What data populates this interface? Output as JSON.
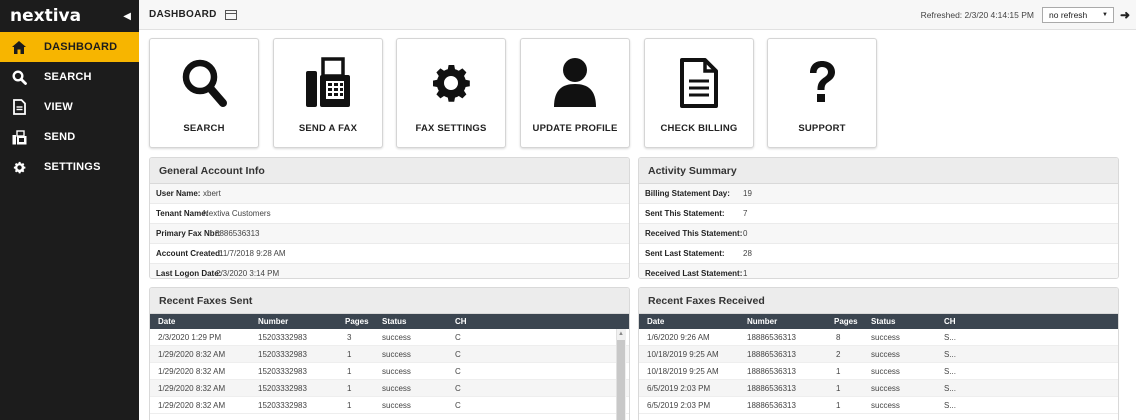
{
  "app": {
    "brand": "nextiva"
  },
  "sidebar": {
    "items": [
      {
        "label": "DASHBOARD",
        "icon": "home-icon",
        "active": true
      },
      {
        "label": "SEARCH",
        "icon": "search-icon",
        "active": false
      },
      {
        "label": "VIEW",
        "icon": "document-icon",
        "active": false
      },
      {
        "label": "SEND",
        "icon": "fax-icon",
        "active": false
      },
      {
        "label": "SETTINGS",
        "icon": "gear-icon",
        "active": false
      }
    ]
  },
  "topbar": {
    "title": "DASHBOARD",
    "refreshed": "Refreshed: 2/3/20 4:14:15 PM",
    "refresh_select": "no refresh"
  },
  "tiles": [
    {
      "label": "SEARCH",
      "icon": "search-icon"
    },
    {
      "label": "SEND A FAX",
      "icon": "fax-icon"
    },
    {
      "label": "FAX SETTINGS",
      "icon": "gear-icon"
    },
    {
      "label": "UPDATE PROFILE",
      "icon": "user-icon"
    },
    {
      "label": "CHECK BILLING",
      "icon": "document-icon"
    },
    {
      "label": "SUPPORT",
      "icon": "question-icon"
    }
  ],
  "account_info": {
    "title": "General Account Info",
    "rows": [
      {
        "key": "User Name:",
        "value": "xbert"
      },
      {
        "key": "Tenant Name:",
        "value": "Nextiva Customers"
      },
      {
        "key": "Primary Fax Nbr:",
        "value": "8886536313"
      },
      {
        "key": "Account Created:",
        "value": "11/7/2018 9:28 AM"
      },
      {
        "key": "Last Logon Date:",
        "value": "2/3/2020 3:14 PM"
      }
    ]
  },
  "activity_summary": {
    "title": "Activity Summary",
    "rows": [
      {
        "key": "Billing Statement Day:",
        "value": "19"
      },
      {
        "key": "Sent This Statement:",
        "value": "7"
      },
      {
        "key": "Received This Statement:",
        "value": "0"
      },
      {
        "key": "Sent Last Statement:",
        "value": "28"
      },
      {
        "key": "Received Last Statement:",
        "value": "1"
      }
    ]
  },
  "recent_sent": {
    "title": "Recent Faxes Sent",
    "columns": [
      "Date",
      "Number",
      "Pages",
      "Status",
      "CH"
    ],
    "rows": [
      [
        "2/3/2020 1:29 PM",
        "15203332983",
        "3",
        "success",
        "C"
      ],
      [
        "1/29/2020 8:32 AM",
        "15203332983",
        "1",
        "success",
        "C"
      ],
      [
        "1/29/2020 8:32 AM",
        "15203332983",
        "1",
        "success",
        "C"
      ],
      [
        "1/29/2020 8:32 AM",
        "15203332983",
        "1",
        "success",
        "C"
      ],
      [
        "1/29/2020 8:32 AM",
        "15203332983",
        "1",
        "success",
        "C"
      ]
    ]
  },
  "recent_received": {
    "title": "Recent Faxes Received",
    "columns": [
      "Date",
      "Number",
      "Pages",
      "Status",
      "CH"
    ],
    "rows": [
      [
        "1/6/2020 9:26 AM",
        "18886536313",
        "8",
        "success",
        "S..."
      ],
      [
        "10/18/2019 9:25 AM",
        "18886536313",
        "2",
        "success",
        "S..."
      ],
      [
        "10/18/2019 9:25 AM",
        "18886536313",
        "1",
        "success",
        "S..."
      ],
      [
        "6/5/2019 2:03 PM",
        "18886536313",
        "1",
        "success",
        "S..."
      ],
      [
        "6/5/2019 2:03 PM",
        "18886536313",
        "1",
        "success",
        "S..."
      ]
    ]
  },
  "colors": {
    "accent": "#f7b500",
    "sidebar": "#1c1c1c",
    "table_header": "#3b4550"
  }
}
